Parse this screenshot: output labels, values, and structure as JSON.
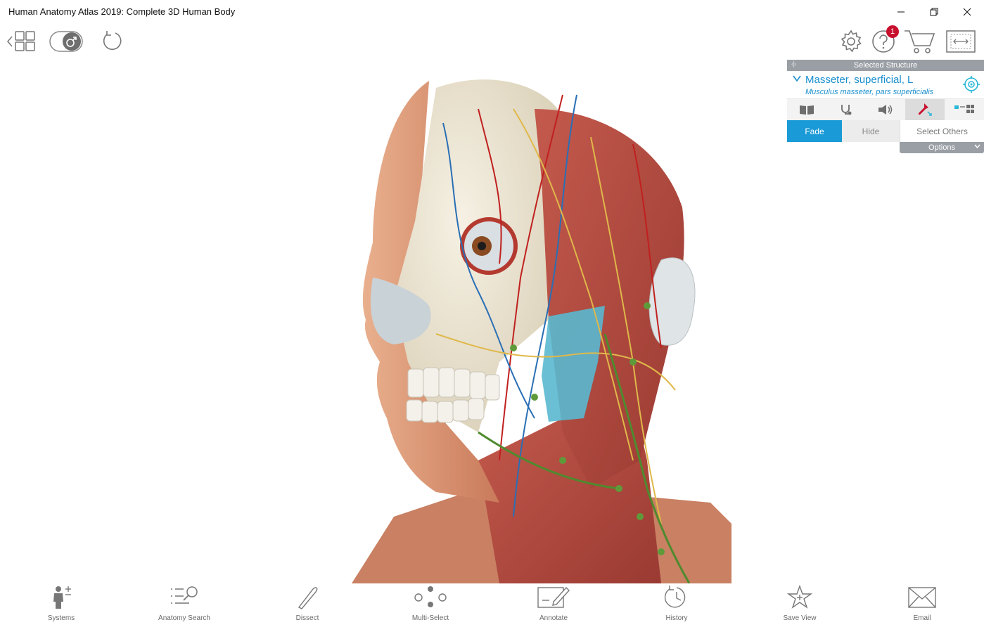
{
  "window": {
    "title": "Human Anatomy Atlas 2019: Complete 3D Human Body"
  },
  "toolbar": {
    "help_badge_count": "1"
  },
  "selected_panel": {
    "header": "Selected Structure",
    "structure_name": "Masseter, superficial, L",
    "structure_latin": "Musculus masseter, pars superficialis",
    "actions": {
      "fade": "Fade",
      "hide": "Hide",
      "select_others": "Select Others"
    },
    "options_label": "Options",
    "accent_color": "#1a9ad6"
  },
  "bottom_nav": [
    {
      "label": "Systems",
      "icon": "person-plus-icon"
    },
    {
      "label": "Anatomy Search",
      "icon": "search-list-icon"
    },
    {
      "label": "Dissect",
      "icon": "scalpel-icon"
    },
    {
      "label": "Multi-Select",
      "icon": "dots-icon"
    },
    {
      "label": "Annotate",
      "icon": "annotate-pencil-icon"
    },
    {
      "label": "History",
      "icon": "clock-history-icon"
    },
    {
      "label": "Save View",
      "icon": "star-plus-icon"
    },
    {
      "label": "Email",
      "icon": "envelope-icon"
    }
  ],
  "colors": {
    "muscle": "#b5483e",
    "bone": "#efe9da",
    "artery": "#c0201f",
    "vein": "#2a6fb5",
    "nerve": "#e0b84a",
    "lymph": "#4f8a2e",
    "skin": "#e2a07d",
    "selected_muscle": "#5ab8cf"
  }
}
